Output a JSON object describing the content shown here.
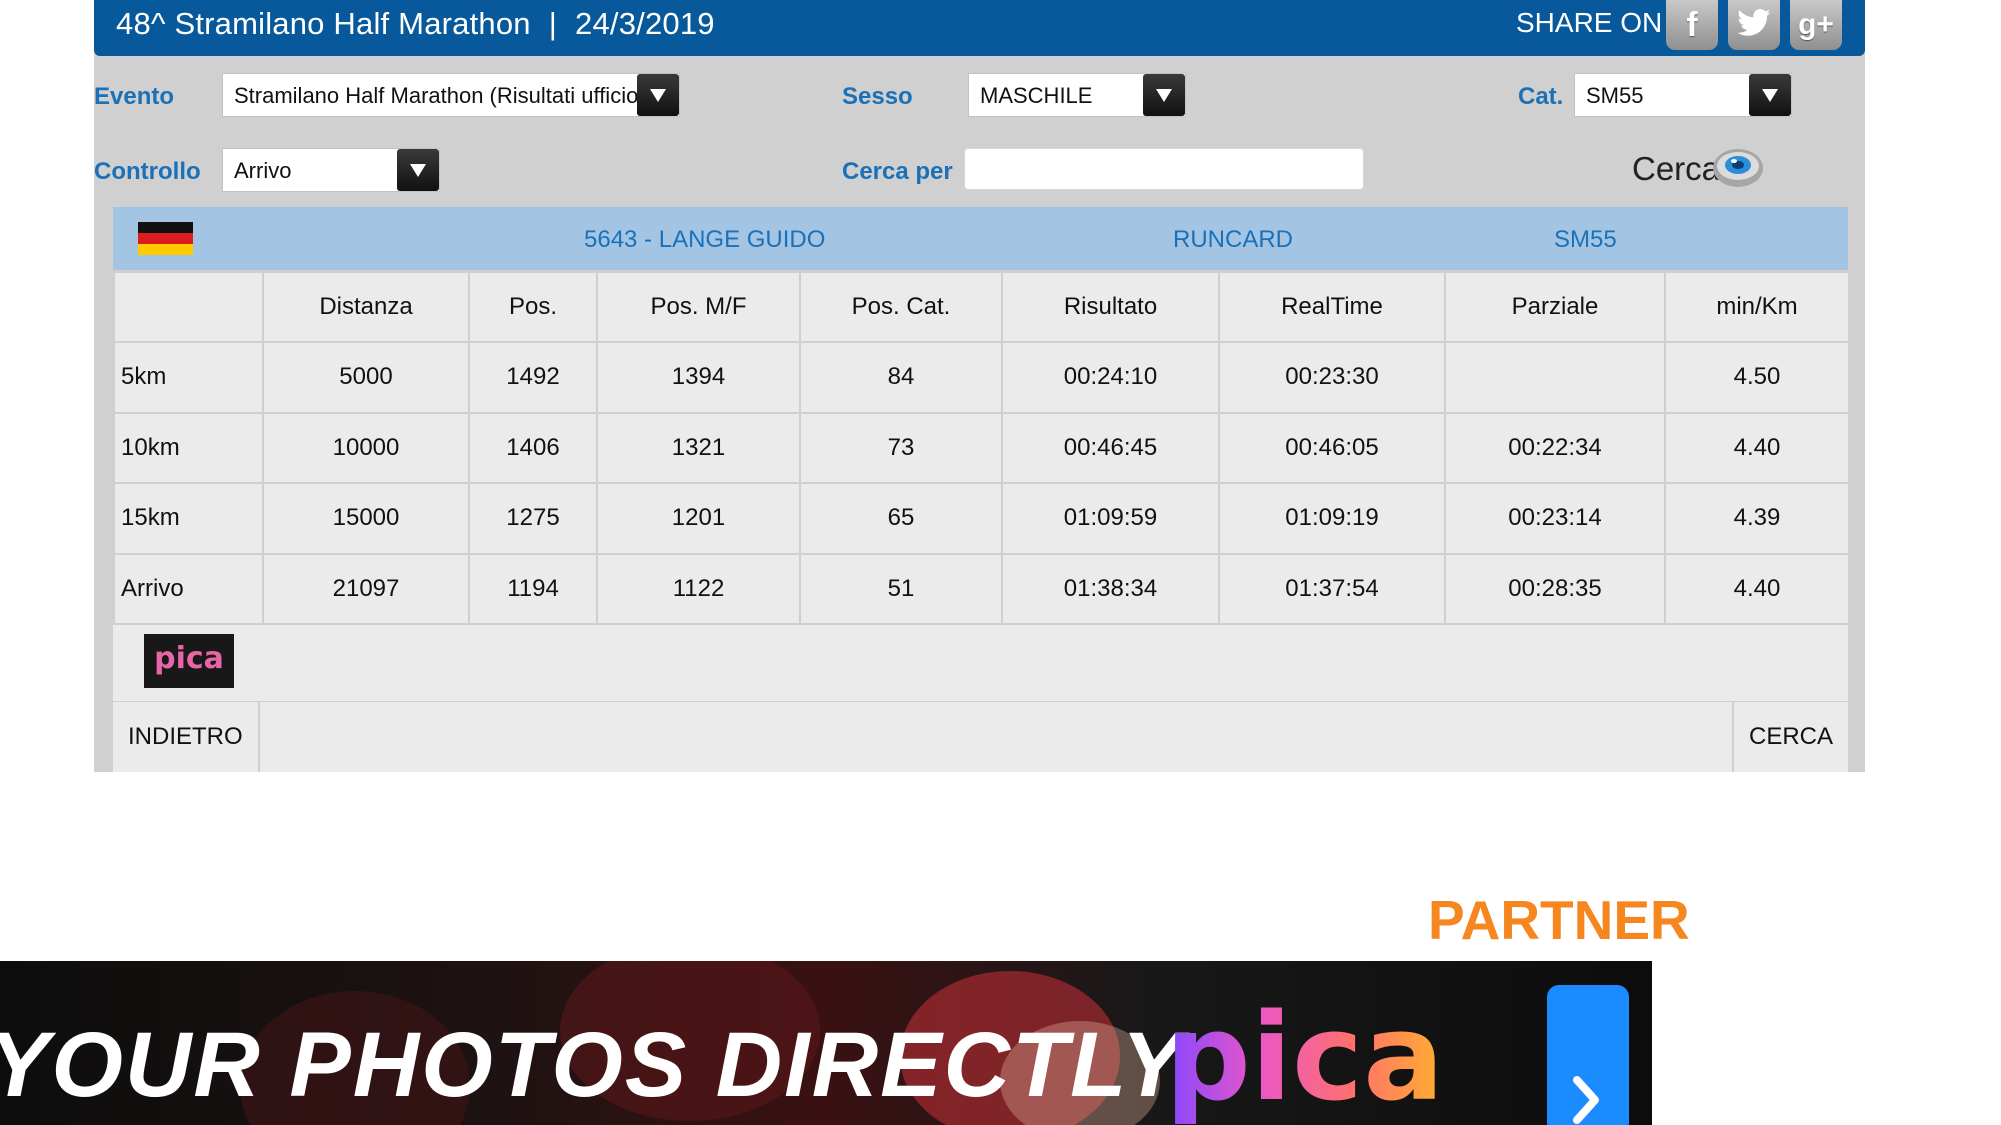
{
  "header": {
    "event_title": "48^ Stramilano Half Marathon",
    "separator": "|",
    "event_date": "24/3/2019",
    "share_label": "SHARE ON",
    "social": [
      {
        "name": "facebook",
        "glyph": "f",
        "icon": "facebook-icon"
      },
      {
        "name": "twitter",
        "icon": "twitter-icon"
      },
      {
        "name": "google-plus",
        "glyph": "g+",
        "icon": "google-plus-icon"
      }
    ]
  },
  "filters": {
    "evento": {
      "label": "Evento",
      "value": "Stramilano Half Marathon (Risultati ufficiosi)"
    },
    "sesso": {
      "label": "Sesso",
      "value": "MASCHILE"
    },
    "cat": {
      "label": "Cat.",
      "value": "SM55"
    },
    "controllo": {
      "label": "Controllo",
      "value": "Arrivo"
    },
    "cerca_per": {
      "label": "Cerca per",
      "value": ""
    },
    "cerca_button": {
      "label": "Cerca",
      "icon": "search-eye-icon"
    }
  },
  "athlete": {
    "flag": "germany-flag-icon",
    "name": "5643 - LANGE GUIDO",
    "club": "RUNCARD",
    "category": "SM55"
  },
  "results": {
    "columns": [
      "",
      "Distanza",
      "Pos.",
      "Pos. M/F",
      "Pos. Cat.",
      "Risultato",
      "RealTime",
      "Parziale",
      "min/Km"
    ],
    "rows": [
      [
        "5km",
        "5000",
        "1492",
        "1394",
        "84",
        "00:24:10",
        "00:23:30",
        "",
        "4.50"
      ],
      [
        "10km",
        "10000",
        "1406",
        "1321",
        "73",
        "00:46:45",
        "00:46:05",
        "00:22:34",
        "4.40"
      ],
      [
        "15km",
        "15000",
        "1275",
        "1201",
        "65",
        "01:09:59",
        "01:09:19",
        "00:23:14",
        "4.39"
      ],
      [
        "Arrivo",
        "21097",
        "1194",
        "1122",
        "51",
        "01:38:34",
        "01:37:54",
        "00:28:35",
        "4.40"
      ]
    ]
  },
  "timing_logo": {
    "text": "pica"
  },
  "nav": {
    "back_label": "INDIETRO",
    "search_label": "CERCA"
  },
  "partner": {
    "heading": "PARTNER",
    "banner_text": "YOUR PHOTOS DIRECTLY",
    "banner_brand": "pica"
  },
  "colors": {
    "header_blue": "#07599b",
    "label_blue": "#1b71b8",
    "athlete_bar": "#a3c5e3",
    "partner_orange": "#f6861f"
  }
}
